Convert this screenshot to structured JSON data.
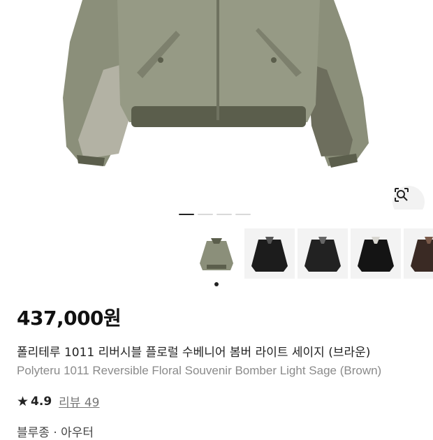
{
  "product": {
    "price": "437,000원",
    "name_ko": "폴리테루 1011 리버시블 플로럴 수베니어 봄버 라이트 세이지 (브라운)",
    "name_en": "Polyteru 1011 Reversible Floral Souvenir Bomber Light Sage (Brown)",
    "rating": "4.9",
    "review_label": "리뷰 49",
    "category": "블루종 · 아우터"
  },
  "gallery": {
    "pages": 4,
    "active_page": 1,
    "thumbnails": [
      {
        "name": "light-sage-jacket",
        "color": "#8b8f7a"
      },
      {
        "name": "black-jacket-1",
        "color": "#1c1c1c"
      },
      {
        "name": "black-jacket-2",
        "color": "#222222"
      },
      {
        "name": "black-jacket-3",
        "color": "#141414"
      },
      {
        "name": "brown-jacket",
        "color": "#3a2a24"
      }
    ],
    "selected_index": 0
  },
  "icons": {
    "lens": "visual-search-icon",
    "star": "star-icon"
  },
  "colors": {
    "jacket": "#8e937e",
    "rib": "#5b5e4c"
  }
}
